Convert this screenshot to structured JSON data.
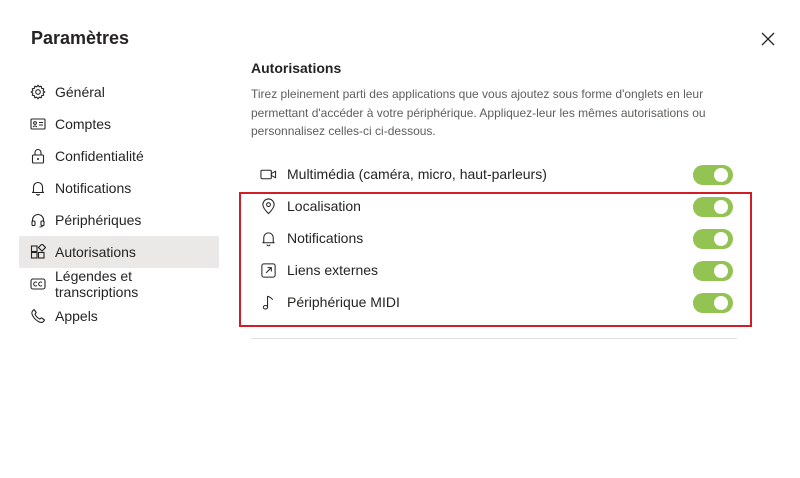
{
  "dialog": {
    "title": "Paramètres",
    "close_icon": "close-icon"
  },
  "sidebar": {
    "items": [
      {
        "label": "Général",
        "icon": "gear-icon",
        "active": false
      },
      {
        "label": "Comptes",
        "icon": "id-card-icon",
        "active": false
      },
      {
        "label": "Confidentialité",
        "icon": "lock-icon",
        "active": false
      },
      {
        "label": "Notifications",
        "icon": "bell-icon",
        "active": false
      },
      {
        "label": "Périphériques",
        "icon": "headset-icon",
        "active": false
      },
      {
        "label": "Autorisations",
        "icon": "apps-icon",
        "active": true
      },
      {
        "label": "Légendes et transcriptions",
        "icon": "closed-caption-icon",
        "active": false
      },
      {
        "label": "Appels",
        "icon": "phone-icon",
        "active": false
      }
    ]
  },
  "main": {
    "section_title": "Autorisations",
    "description": "Tirez pleinement parti des applications que vous ajoutez sous forme d'onglets en leur permettant d'accéder à votre périphérique. Appliquez-leur les mêmes autorisations ou personnalisez celles-ci ci-dessous.",
    "permissions": [
      {
        "label": "Multimédia (caméra, micro, haut-parleurs)",
        "icon": "video-camera-icon",
        "enabled": true
      },
      {
        "label": "Localisation",
        "icon": "location-pin-icon",
        "enabled": true
      },
      {
        "label": "Notifications",
        "icon": "bell-icon",
        "enabled": true
      },
      {
        "label": "Liens externes",
        "icon": "external-link-icon",
        "enabled": true
      },
      {
        "label": "Périphérique MIDI",
        "icon": "music-note-icon",
        "enabled": true
      }
    ]
  },
  "colors": {
    "toggle_on": "#92c353",
    "highlight_border": "#d01f24",
    "active_nav_bg": "#ebe9e7"
  }
}
